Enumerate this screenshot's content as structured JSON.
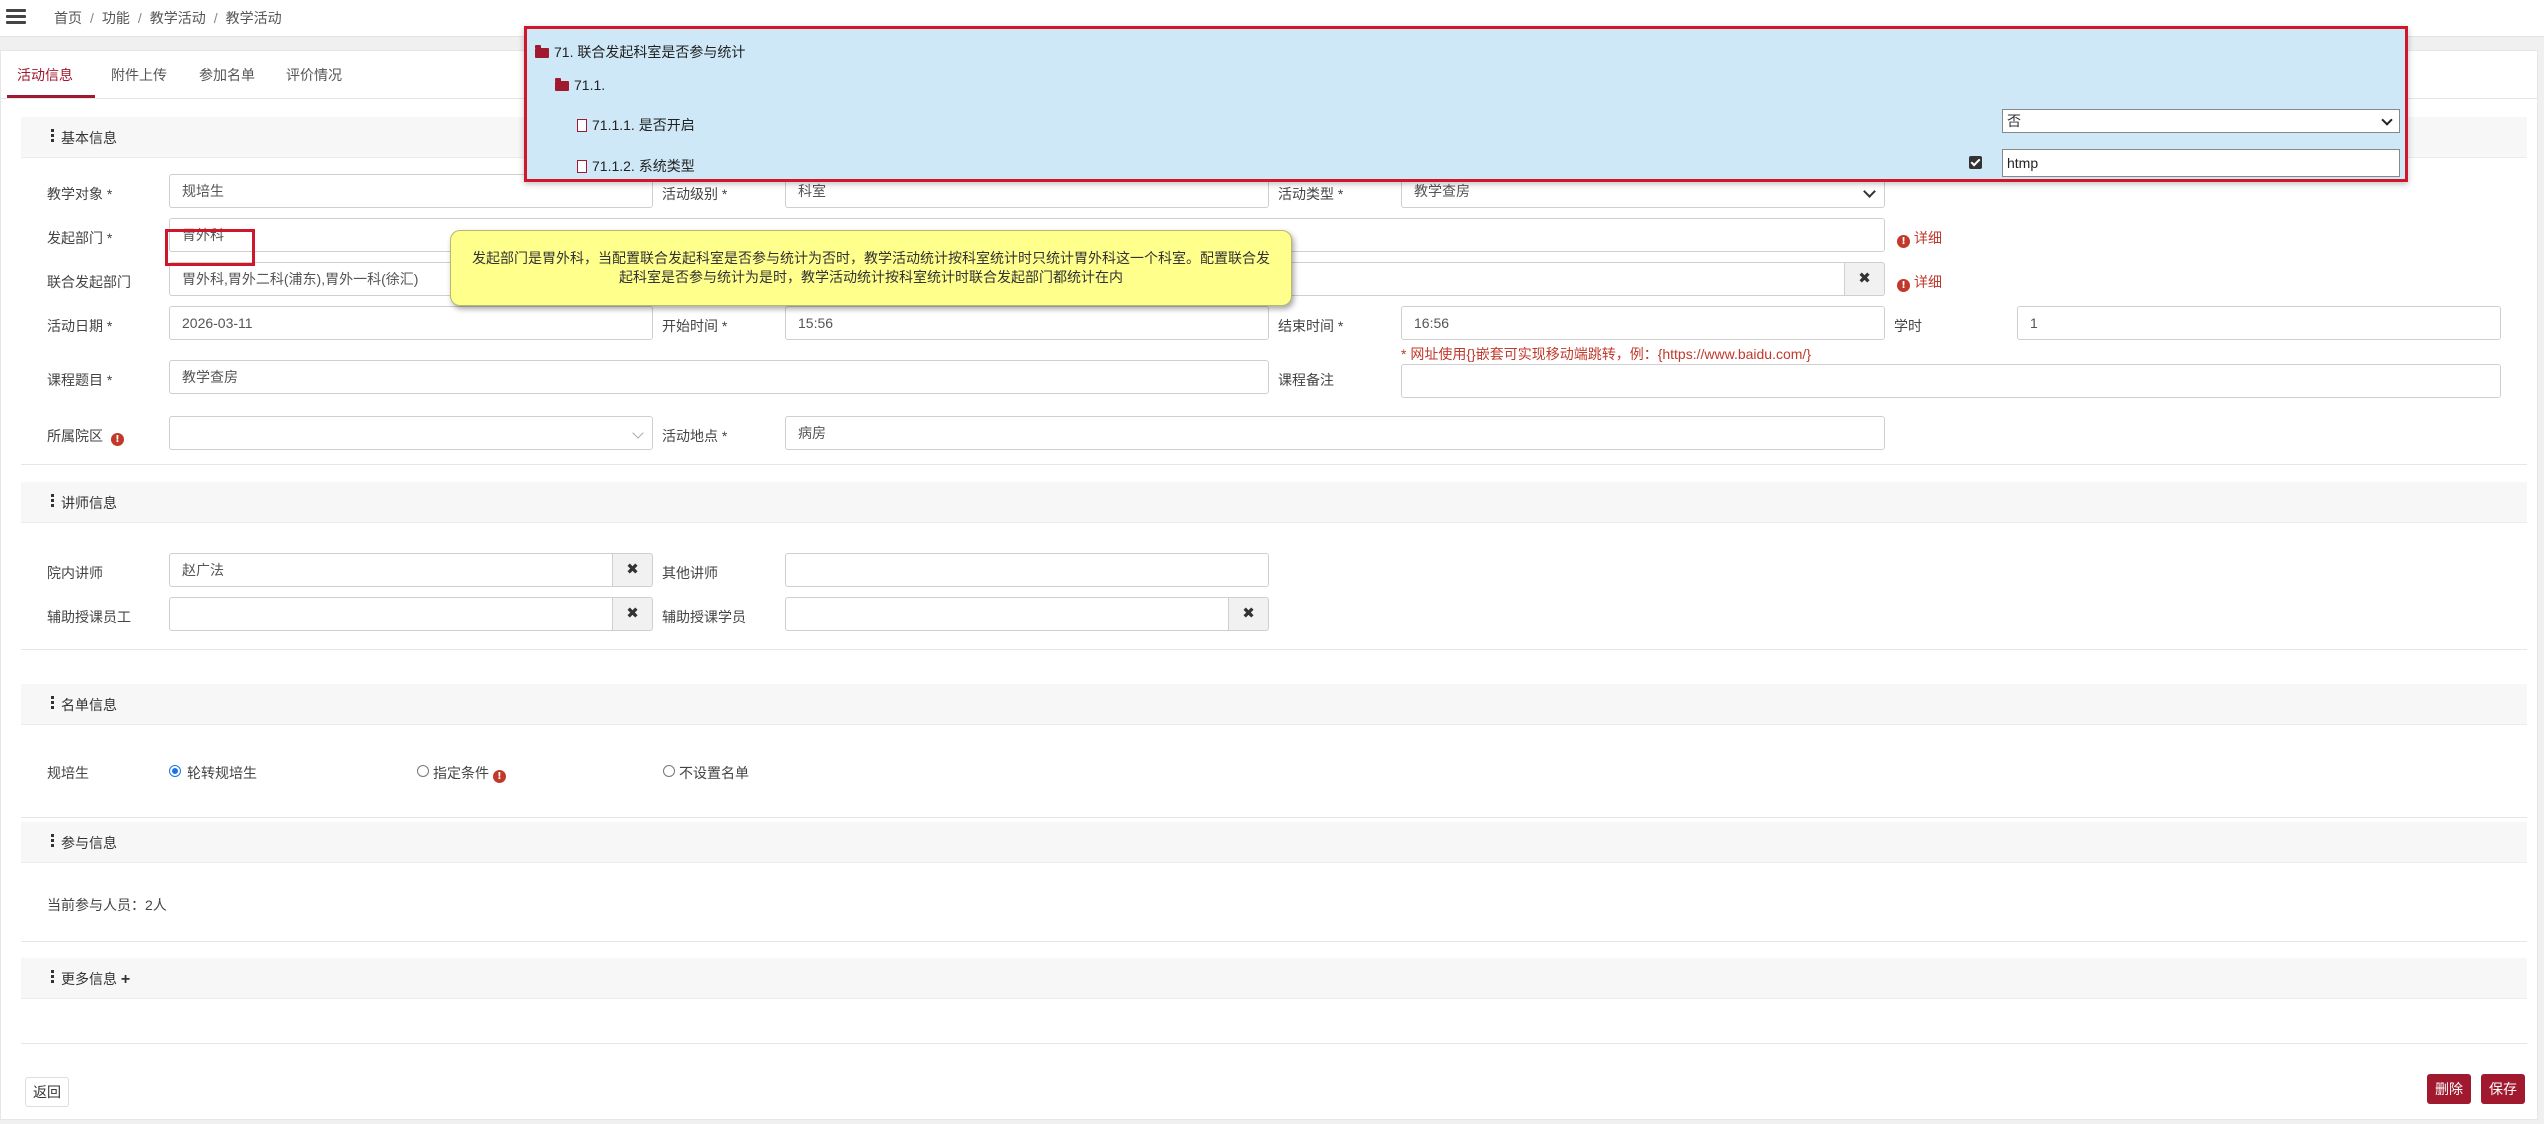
{
  "breadcrumb": [
    "首页",
    "功能",
    "教学活动",
    "教学活动"
  ],
  "tabs": [
    "活动信息",
    "附件上传",
    "参加名单",
    "评价情况"
  ],
  "config_panel": {
    "root": "71. 联合发起科室是否参与统计",
    "group": "71.1.",
    "item1_label": "71.1.1. 是否开启",
    "item1_value": "否",
    "item2_label": "71.1.2. 系统类型",
    "item2_value": "htmp"
  },
  "note": "发起部门是胃外科，当配置联合发起科室是否参与统计为否时，教学活动统计按科室统计时只统计胃外科这一个科室。配置联合发起科室是否参与统计为是时，教学活动统计按科室统计时联合发起部门都统计在内",
  "sections": {
    "basic": "基本信息",
    "teacher": "讲师信息",
    "roster": "名单信息",
    "participation": "参与信息",
    "more": "更多信息"
  },
  "basic": {
    "target_label": "教学对象 *",
    "target_value": "规培生",
    "level_label": "活动级别 *",
    "level_value": "科室",
    "type_label": "活动类型 *",
    "type_value": "教学查房",
    "dept_label": "发起部门 *",
    "dept_value": "胃外科",
    "detail_text": "详细",
    "joint_label": "联合发起部门",
    "joint_value": "胃外科,胃外二科(浦东),胃外一科(徐汇)",
    "date_label": "活动日期 *",
    "date_value": "2026-03-11",
    "start_label": "开始时间 *",
    "start_value": "15:56",
    "end_label": "结束时间 *",
    "end_value": "16:56",
    "hours_label": "学时",
    "hours_value": "1",
    "course_label": "课程题目 *",
    "course_value": "教学查房",
    "remark_label": "课程备注",
    "remark_hint": "* 网址使用{}嵌套可实现移动端跳转，例：{https://www.baidu.com/}",
    "campus_label": "所属院区",
    "place_label": "活动地点 *",
    "place_value": "病房"
  },
  "teacher": {
    "inner_label": "院内讲师",
    "inner_value": "赵广法",
    "other_label": "其他讲师",
    "assist_staff_label": "辅助授课员工",
    "assist_student_label": "辅助授课学员"
  },
  "roster": {
    "label": "规培生",
    "options": [
      "轮转规培生",
      "指定条件",
      "不设置名单"
    ],
    "selected": "轮转规培生"
  },
  "participation": {
    "count_text": "当前参与人员：2人"
  },
  "footer": {
    "back": "返回",
    "delete": "删除",
    "save": "保存"
  },
  "colors": {
    "brand": "#a0192e",
    "highlight": "#d0162b",
    "note_bg": "#ffff8c",
    "panel_bg": "#cfe8f7"
  }
}
